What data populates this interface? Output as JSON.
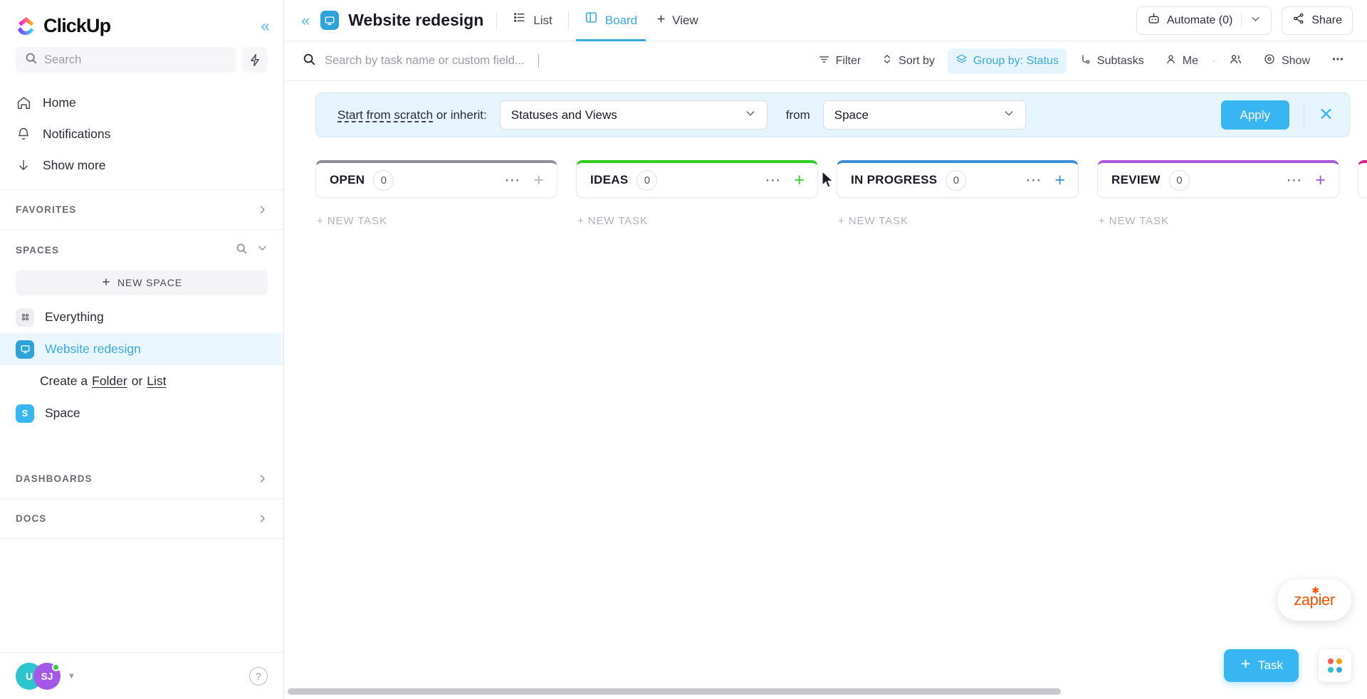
{
  "brand": {
    "name": "ClickUp",
    "accent": "#38b6f1",
    "active_blue": "#3aa8e0"
  },
  "sidebar": {
    "collapse_icon": "chevrons-left-icon",
    "search": {
      "placeholder": "Search",
      "icon": "search-icon"
    },
    "bolt_icon": "lightning-bolt-icon",
    "nav": [
      {
        "label": "Home",
        "icon": "home-icon"
      },
      {
        "label": "Notifications",
        "icon": "bell-icon"
      },
      {
        "label": "Show more",
        "icon": "arrow-down-icon"
      }
    ],
    "favorites": {
      "label": "FAVORITES",
      "chevron": "chevron-right-icon"
    },
    "spaces": {
      "label": "SPACES",
      "search_icon": "search-icon",
      "chevron": "chevron-down-icon",
      "new_space_label": "NEW SPACE",
      "items": [
        {
          "label": "Everything",
          "icon": "grid-dots-icon",
          "badge_color": "#eeeef1",
          "active": false
        },
        {
          "label": "Website redesign",
          "icon": "monitor-icon",
          "badge_color": "#2ea3d8",
          "active": true
        }
      ],
      "create_row": {
        "prefix": "Create a",
        "folder": "Folder",
        "middle": "or",
        "list": "List"
      },
      "space_entry": {
        "label": "Space",
        "initial": "S",
        "badge_color": "#38b6f1"
      }
    },
    "dashboards": {
      "label": "DASHBOARDS",
      "chevron": "chevron-right-icon"
    },
    "docs": {
      "label": "DOCS",
      "chevron": "chevron-right-icon"
    },
    "footer": {
      "avatars": [
        {
          "initials": "U",
          "color": "#2ec4cd"
        },
        {
          "initials": "SJ",
          "color": "#a557e8",
          "online": true
        }
      ],
      "caret": "caret-down-icon",
      "help_label": "?"
    }
  },
  "header": {
    "title": "Website redesign",
    "title_icon": "monitor-icon",
    "collapse_icon": "chevrons-left-icon",
    "tabs": [
      {
        "label": "List",
        "icon": "list-icon",
        "active": false
      },
      {
        "label": "Board",
        "icon": "board-icon",
        "active": true
      }
    ],
    "add_view": {
      "label": "View",
      "icon": "plus-icon"
    },
    "automate": {
      "label": "Automate (0)",
      "icon": "robot-icon",
      "chevron": "chevron-down-icon"
    },
    "share": {
      "label": "Share",
      "icon": "share-nodes-icon"
    }
  },
  "toolbar": {
    "search_placeholder": "Search by task name or custom field...",
    "search_icon": "search-icon",
    "items": [
      {
        "label": "Filter",
        "icon": "filter-icon",
        "highlighted": false
      },
      {
        "label": "Sort by",
        "icon": "sort-icon",
        "highlighted": false
      },
      {
        "label": "Group by: Status",
        "icon": "layers-icon",
        "highlighted": true
      },
      {
        "label": "Subtasks",
        "icon": "subtask-icon",
        "highlighted": false
      },
      {
        "label": "Me",
        "icon": "person-icon",
        "highlighted": false
      },
      {
        "label": "",
        "icon": "people-icon",
        "highlighted": false
      },
      {
        "label": "Show",
        "icon": "eye-icon",
        "highlighted": false
      },
      {
        "label": "",
        "icon": "ellipsis-icon",
        "highlighted": false
      }
    ]
  },
  "banner": {
    "scratch_label": "Start from scratch",
    "or_inherit": " or inherit:",
    "inherit_value": "Statuses and Views",
    "from_label": "from",
    "from_value": "Space",
    "apply_label": "Apply",
    "close_icon": "close-icon",
    "chevron": "chevron-down-icon"
  },
  "board": {
    "new_task_label": "+ NEW TASK",
    "dots_icon": "ellipsis-icon",
    "plus_icon": "plus-icon",
    "columns": [
      {
        "name": "OPEN",
        "count": "0",
        "color": "#8e8e9c"
      },
      {
        "name": "IDEAS",
        "count": "0",
        "color": "#2ecc1e"
      },
      {
        "name": "IN PROGRESS",
        "count": "0",
        "color": "#3e8fd6"
      },
      {
        "name": "REVIEW",
        "count": "0",
        "color": "#a855d8"
      },
      {
        "name": "",
        "count": "",
        "color": "#e01b84"
      }
    ]
  },
  "floating": {
    "zapier_label": "zapier",
    "task_button": {
      "label": "Task",
      "icon": "plus-icon"
    },
    "grid_button": {
      "icon": "apps-grid-icon",
      "colors": [
        "#f25c54",
        "#f0a202",
        "#2ec4cd",
        "#3aa8e0"
      ]
    }
  }
}
